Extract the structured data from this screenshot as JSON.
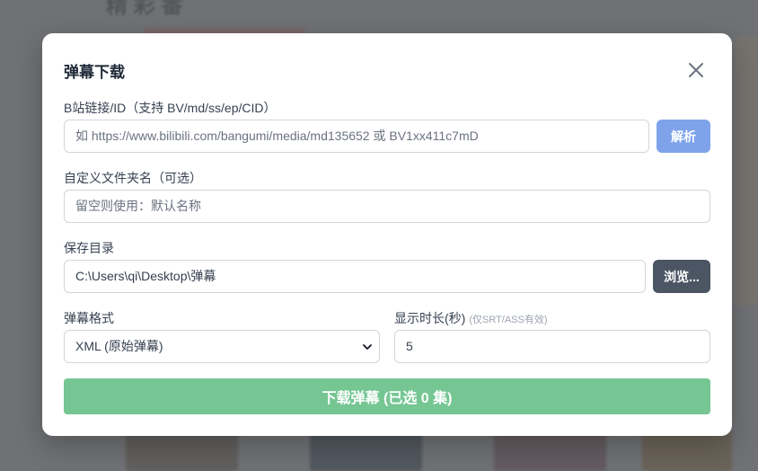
{
  "background": {
    "title": "精 彩 番"
  },
  "dialog": {
    "title": "弹幕下载",
    "link_label": "B站链接/ID（支持 BV/md/ss/ep/CID）",
    "link_placeholder": "如 https://www.bilibili.com/bangumi/media/md135652 或 BV1xx411c7mD",
    "parse_button": "解析",
    "folder_label": "自定义文件夹名（可选）",
    "folder_placeholder": "留空则使用：默认名称",
    "save_label": "保存目录",
    "save_path": "C:\\Users\\qi\\Desktop\\弹幕",
    "browse_button": "浏览...",
    "format_label": "弹幕格式",
    "format_value": "XML (原始弹幕)",
    "duration_label": "显示时长(秒)",
    "duration_hint": "(仅SRT/ASS有效)",
    "duration_value": "5",
    "download_button": "下载弹幕 (已选 0 集)"
  },
  "colors": {
    "parse_button": "#7ea3ea",
    "browse_button": "#4b5563",
    "download_button": "#75c693"
  },
  "icons": {
    "close": "close-icon",
    "select_arrow": "chevron-down-icon"
  }
}
